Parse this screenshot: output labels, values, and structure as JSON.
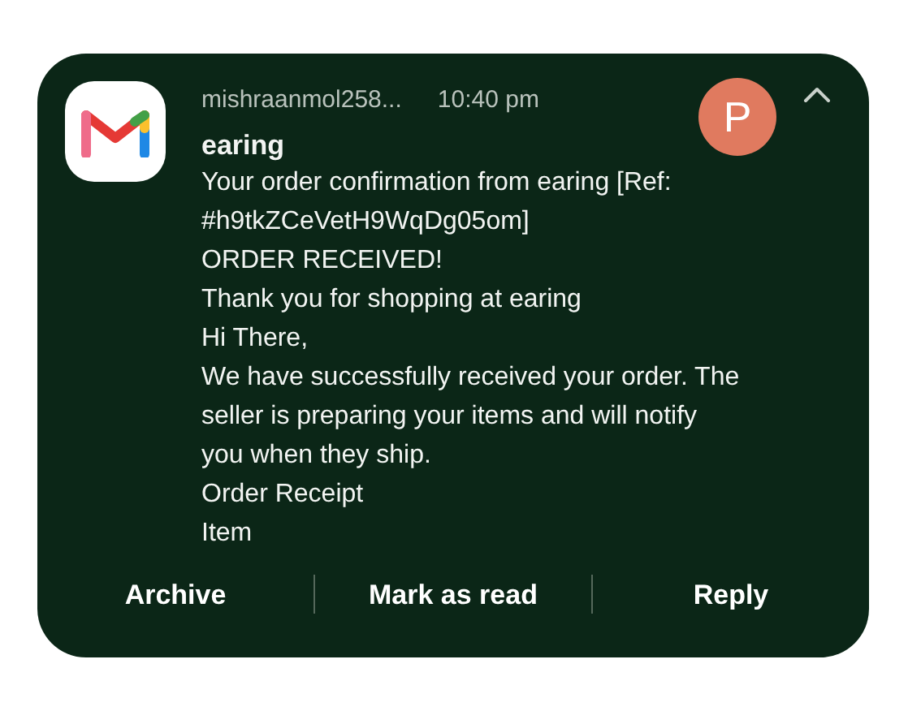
{
  "notification": {
    "sender": "mishraanmol258...",
    "time": "10:40 pm",
    "avatar_letter": "P",
    "expanded": true,
    "subject": "earing",
    "body_lines": [
      "Your order confirmation from earing [Ref:",
      "#h9tkZCeVetH9WqDg05om]",
      "ORDER RECEIVED!",
      "Thank you for shopping at earing",
      "Hi There,",
      "We have successfully received your order. The",
      "seller is preparing your items and will notify",
      "you when they ship.",
      "Order Receipt",
      "Item"
    ],
    "actions": [
      "Archive",
      "Mark as read",
      "Reply"
    ]
  }
}
